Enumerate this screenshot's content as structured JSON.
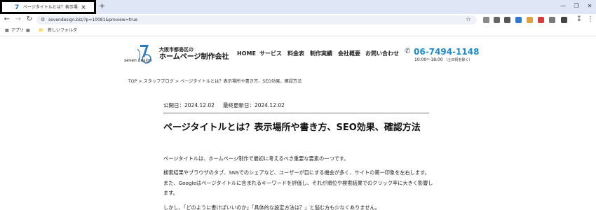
{
  "browser": {
    "tab_title": "ページタイトルとは？表示場所や書",
    "tab_close": "×",
    "new_tab": "+",
    "url": "sevendesign.biz/?p=10081&preview=true",
    "bookmarks": {
      "apps_label": "アプリ",
      "folder_label": "新しいフォルダ"
    }
  },
  "site": {
    "logo": {
      "mark_text": "seven design",
      "subtitle": "大阪市都島区の",
      "title": "ホームページ制作会社"
    },
    "nav": [
      "HOME",
      "サービス",
      "料金表",
      "制作実績",
      "会社概要",
      "お問い合わせ"
    ],
    "phone": "06-7494-1148",
    "hours": "10:00〜18:00",
    "hours_note": "（土日祝を除く）"
  },
  "breadcrumb": [
    "TOP",
    ">",
    "スタッフブログ",
    ">",
    "ページタイトルとは？表示場所や書き方、SEO効果、確認方法"
  ],
  "article": {
    "published": "公開日：2024.12.02",
    "updated": "最終更新日：2024.12.02",
    "title": "ページタイトルとは？表示場所や書き方、SEO効果、確認方法",
    "paragraphs": [
      "ページタイトルは、ホームページ制作で最初に考えるべき重要な要素の一つです。",
      "検索結果やブラウザのタブ、SNSでのシェアなど、ユーザーが目にする機会が多く、サイトの第一印象を左右します。また、Googleはページタイトルに含まれるキーワードを評価し、それが順位や検索結果でのクリック率に大きく影響します。",
      "しかし、「どのように書けばいいのか」「具体的な設定方法は？」と悩む方も少なくありません。"
    ]
  },
  "colors": {
    "tabstrip": "#dfe6f5",
    "phone_accent": "#1b8ac7",
    "logo_blue": "#2b7bc0"
  }
}
